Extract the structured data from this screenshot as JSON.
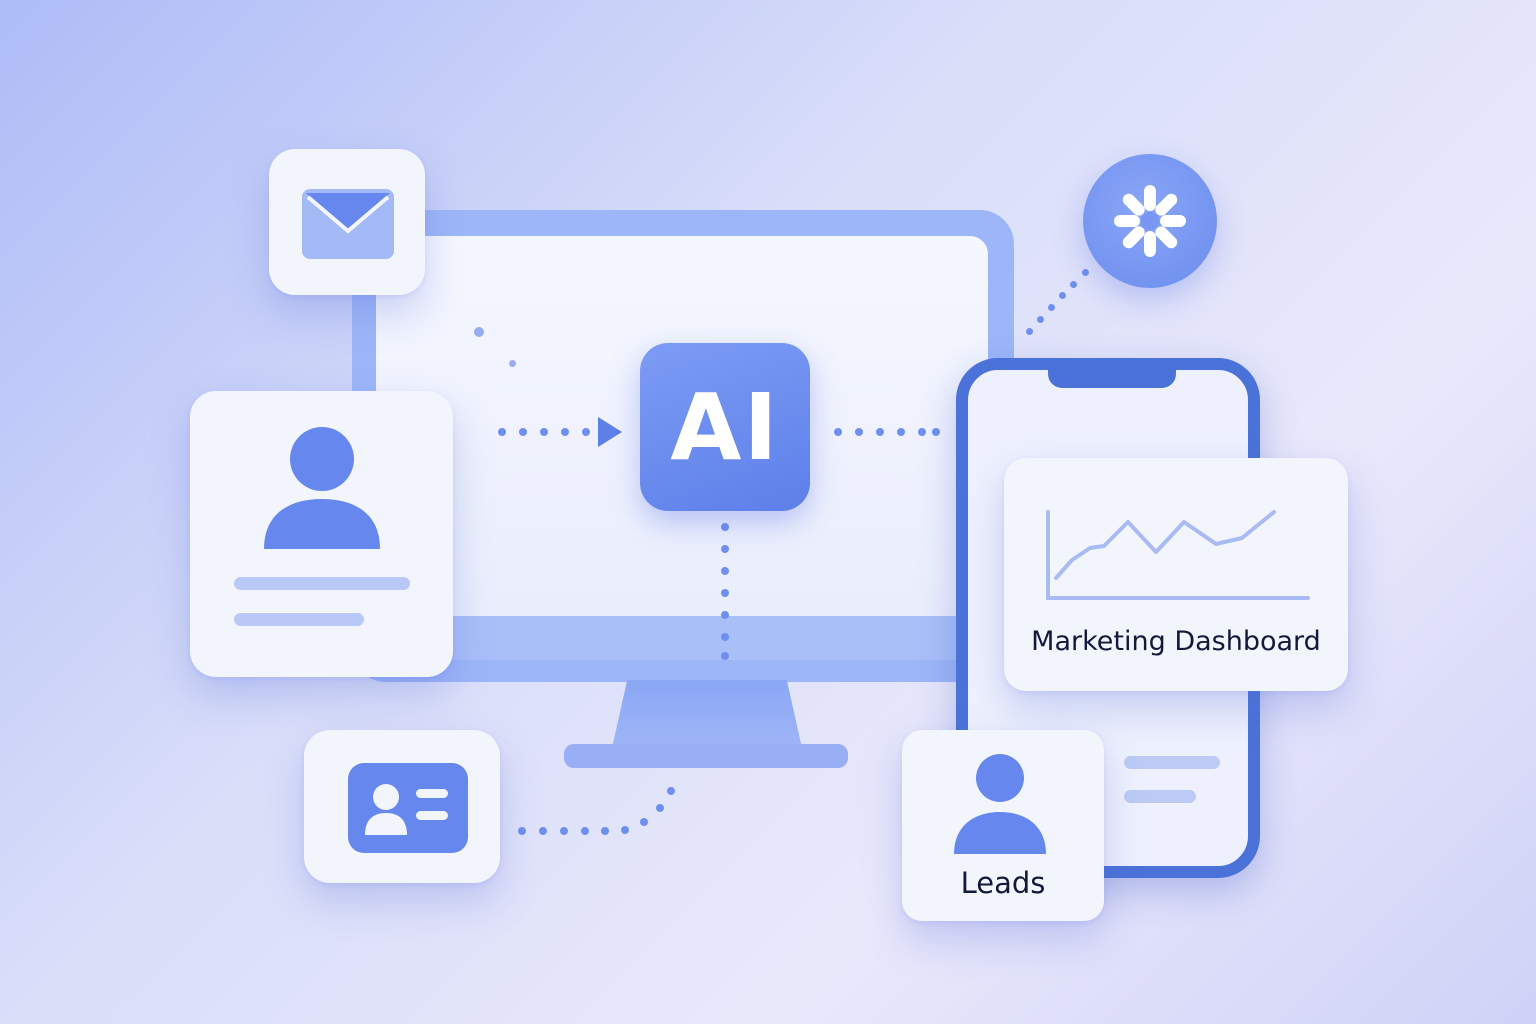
{
  "center": {
    "label": "AI"
  },
  "dashboard_card": {
    "title": "Marketing Dashboard"
  },
  "leads_card": {
    "title": "Leads"
  },
  "colors": {
    "accent": "#6a8cee",
    "accent_dark": "#4a72d8",
    "card_bg": "#f3f5fd",
    "text": "#111a3b"
  },
  "icons": {
    "email": "mail-icon",
    "user": "user-icon",
    "contact_card": "id-card-icon",
    "integration": "asterisk-icon",
    "chart": "line-chart-icon"
  }
}
